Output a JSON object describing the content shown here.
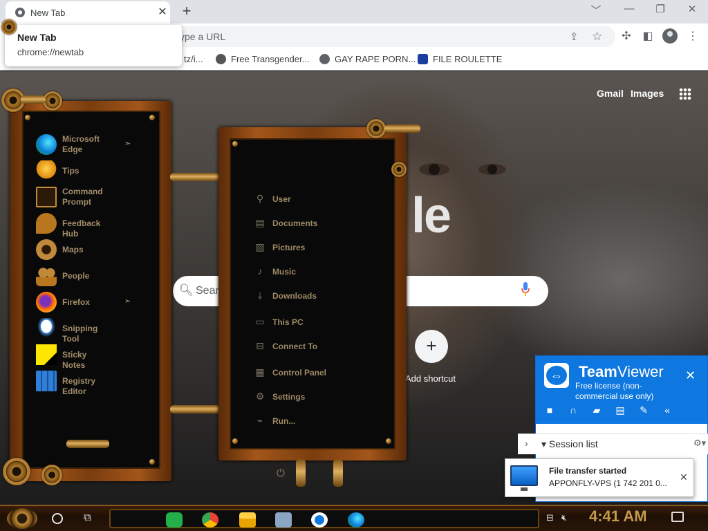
{
  "browser": {
    "tab_title": "New Tab",
    "tab_close": "✕",
    "new_tab": "+",
    "win_minimize": "﹀",
    "win_min2": "—",
    "win_restore": "❐",
    "win_close": "✕",
    "omnibox_placeholder": "ype a URL",
    "bookmarks": [
      {
        "label": "tz/i..."
      },
      {
        "label": "Free Transgender..."
      },
      {
        "label": "GAY RAPE PORN..."
      },
      {
        "label": "FILE ROULETTE"
      }
    ],
    "tooltip": {
      "title": "New Tab",
      "url": "chrome://newtab"
    }
  },
  "newtab": {
    "links": {
      "gmail": "Gmail",
      "images": "Images"
    },
    "logo_fragment": "le",
    "search_placeholder": "Sear",
    "shortcut_plus": "+",
    "shortcut_label": "Add shortcut"
  },
  "start_menu": {
    "apps": [
      {
        "label": "Microsoft\nEdge",
        "icon": "edge-icon",
        "arrow": true
      },
      {
        "label": "Tips",
        "icon": "lightbulb-icon"
      },
      {
        "label": "Command\nPrompt",
        "icon": "cmd-icon"
      },
      {
        "label": "Feedback Hub",
        "icon": "feedback-icon"
      },
      {
        "label": "Maps",
        "icon": "maps-icon"
      },
      {
        "label": "People",
        "icon": "people-icon"
      },
      {
        "label": "Firefox",
        "icon": "firefox-icon",
        "arrow": true
      },
      {
        "label": "Snipping Tool",
        "icon": "snipping-icon"
      },
      {
        "label": "Sticky Notes",
        "icon": "sticky-icon"
      },
      {
        "label": "Registry Editor",
        "icon": "registry-icon"
      }
    ],
    "places": [
      {
        "label": "User",
        "icon": "user-icon"
      },
      {
        "label": "Documents",
        "icon": "document-icon"
      },
      {
        "label": "Pictures",
        "icon": "picture-icon"
      },
      {
        "label": "Music",
        "icon": "music-icon"
      },
      {
        "label": "Downloads",
        "icon": "download-icon"
      },
      {
        "label": "This PC",
        "icon": "pc-icon"
      },
      {
        "label": "Connect To",
        "icon": "connect-icon"
      },
      {
        "label": "Control Panel",
        "icon": "control-panel-icon"
      },
      {
        "label": "Settings",
        "icon": "settings-icon"
      },
      {
        "label": "Run...",
        "icon": "run-icon"
      }
    ]
  },
  "teamviewer": {
    "title_bold": "Team",
    "title_rest": "Viewer",
    "license": "Free license (non-commercial use only)",
    "close": "✕",
    "session_list": "Session list",
    "toast_title": "File transfer started",
    "toast_body": "APPONFLY-VPS (1 742 201 0...",
    "toast_close": "✕"
  },
  "taskbar": {
    "clock": "4:41 AM"
  },
  "colors": {
    "chrome_bg": "#dee1e6",
    "teamviewer_blue": "#0e78e0",
    "copper": "#a3561a",
    "menu_text": "#a38d6a",
    "clock_gold": "#c49a4a"
  }
}
